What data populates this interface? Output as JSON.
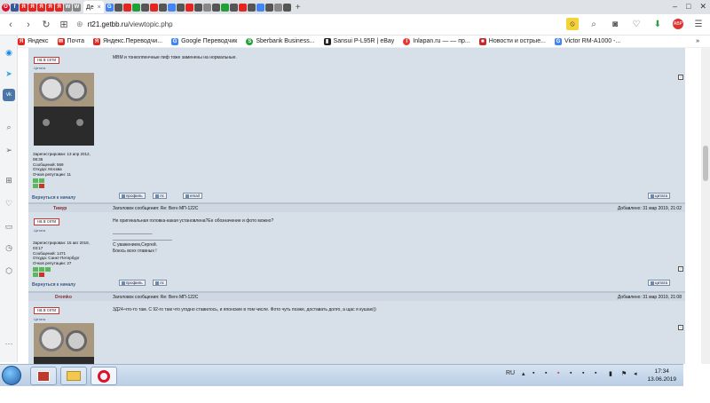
{
  "tabs": {
    "active_title": "Де",
    "mini_labels": [
      "f",
      "Я",
      "Я",
      "Я",
      "Я",
      "Я",
      "W",
      "W",
      "G"
    ],
    "plus": "+",
    "window_controls": [
      "–",
      "□",
      "✕"
    ]
  },
  "navbar": {
    "url_host": "rt21.getbb.ru",
    "url_path": "/viewtopic.php"
  },
  "bookmarks": [
    {
      "label": "Яндекс",
      "color": "#e52620",
      "icon": "Я"
    },
    {
      "label": "Почта",
      "color": "#e52620",
      "icon": "✉"
    },
    {
      "label": "Яндекс.Переводчи...",
      "color": "#e52620",
      "icon": "Я"
    },
    {
      "label": "Google Переводчик",
      "color": "#4285f4",
      "icon": "G"
    },
    {
      "label": "Sberbank Business...",
      "color": "#21a038",
      "icon": "S"
    },
    {
      "label": "Sansui P-L95R | eBay",
      "color": "#222222",
      "icon": "▮"
    },
    {
      "label": "Inlapan.ru — — пр...",
      "color": "#e53935",
      "icon": "I"
    },
    {
      "label": "Новости и острые...",
      "color": "#c62828",
      "icon": "■"
    },
    {
      "label": "Victor RM-A1000 -...",
      "color": "#4285f4",
      "icon": "G"
    }
  ],
  "forum": {
    "online_label": "на в сети",
    "quote_label": "Цитата",
    "back_to_top": "Вернуться к началу",
    "btn_profile": "профиль",
    "btn_pm": "лс",
    "btn_email": "email",
    "btn_quote": "цитата",
    "post1": {
      "text": "МВМ и тонколпенчные пиф тоже заменены на нормальные.",
      "reg": "Зарегистрирован: 13 апр 2012, 08:35",
      "messages": "Сообщений: 569",
      "from": "Откуда: Москва",
      "rep": "Очков репутации: 11"
    },
    "post2": {
      "author": "Тимур",
      "subject": "Заголовок сообщения: Re: Вегн МП-122С",
      "added": "Добавлено: 31 мар 2019, 21:02",
      "line1": "Не оригинальная головка-какая установлена?Ее обозначение и фото можно?",
      "line2": "________________",
      "line3": "________________________",
      "line4": "С уважением,Сергей.",
      "line5": "Боюсь всех главных !",
      "reg": "Зарегистрирован: 15 авг 2018, 03:17",
      "messages": "Сообщений: 1471",
      "from": "Откуда: Санкт-Петербург",
      "rep": "Очков репутации: 27"
    },
    "post3": {
      "author": "Dromko",
      "subject": "Заголовок сообщения: Re: Вегн МП-122С",
      "added": "Добавлено: 31 мар 2019, 21:08",
      "text": "3Д24-что-то там. С 92-го там что угодно ставилось, и японские в том числе. Фото чуть позже, доставать долго, а щас я кушаю))"
    }
  },
  "taskbar": {
    "lang": "RU",
    "time": "17:34",
    "date": "13.06.2019"
  }
}
